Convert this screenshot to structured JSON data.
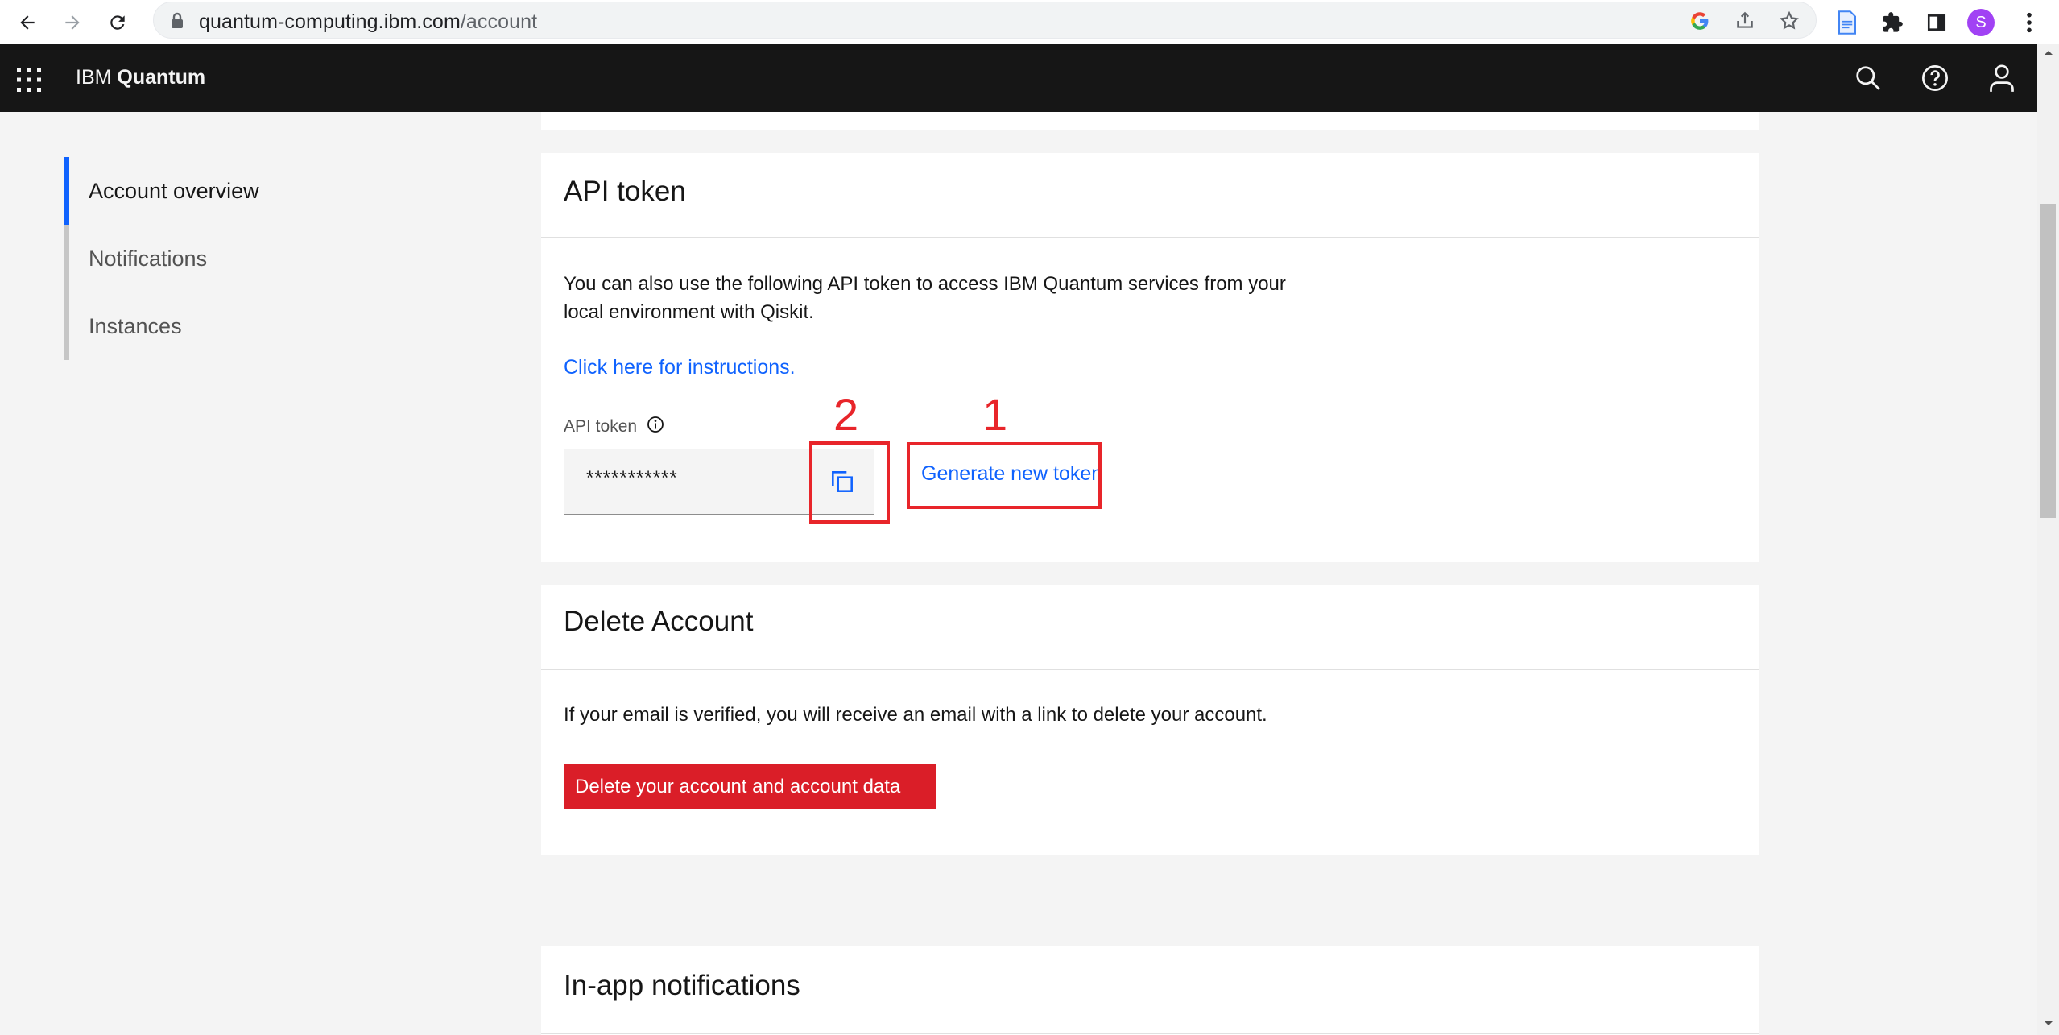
{
  "browser": {
    "url_host": "quantum-computing.ibm.com",
    "url_path": "/account",
    "profile_initial": "S",
    "icons": [
      "back-icon",
      "forward-icon",
      "reload-icon",
      "lock-icon",
      "google-icon",
      "share-icon",
      "bookmark-star-icon",
      "document-icon",
      "extensions-puzzle-icon",
      "side-panel-icon",
      "profile-avatar",
      "more-menu-icon"
    ]
  },
  "header": {
    "brand_prefix": "IBM",
    "brand_name": "Quantum",
    "icons": [
      "app-switcher-grid-icon",
      "search-icon",
      "help-icon",
      "user-icon"
    ]
  },
  "sidebar": {
    "items": [
      {
        "label": "Account overview",
        "active": true
      },
      {
        "label": "Notifications",
        "active": false
      },
      {
        "label": "Instances",
        "active": false
      }
    ]
  },
  "api_token_card": {
    "title": "API token",
    "description_line1": "You can also use the following API token to access IBM Quantum services from your",
    "description_line2": "local environment with Qiskit.",
    "instructions_link": "Click here for instructions.",
    "field_label": "API token",
    "token_value": "***********",
    "generate_label": "Generate new token",
    "annotation_1": "1",
    "annotation_2": "2"
  },
  "delete_card": {
    "title": "Delete Account",
    "description": "If your email is verified, you will receive an email with a link to delete your account.",
    "button_label": "Delete your account and account data"
  },
  "notifications_card": {
    "title": "In-app notifications"
  },
  "colors": {
    "ibm_blue": "#0f62fe",
    "danger_red": "#da1e28",
    "annotation_red": "#e8252a",
    "header_bg": "#161616",
    "page_bg": "#f4f4f4"
  }
}
